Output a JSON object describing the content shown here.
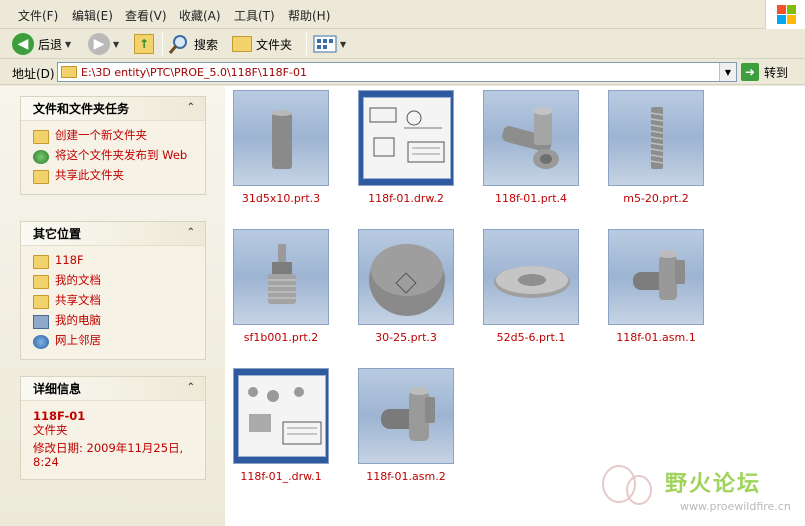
{
  "menu": [
    {
      "label": "文件(F)"
    },
    {
      "label": "编辑(E)"
    },
    {
      "label": "查看(V)"
    },
    {
      "label": "收藏(A)"
    },
    {
      "label": "工具(T)"
    },
    {
      "label": "帮助(H)"
    }
  ],
  "toolbar": {
    "back_label": "后退",
    "search_label": "搜索",
    "folders_label": "文件夹"
  },
  "address": {
    "label": "地址(D)",
    "path": "E:\\3D entity\\PTC\\PROE_5.0\\118F\\118F-01",
    "go_label": "转到"
  },
  "tasks": {
    "title": "文件和文件夹任务",
    "items": [
      {
        "label": "创建一个新文件夹",
        "icon": "new-folder-icon"
      },
      {
        "label": "将这个文件夹发布到 Web",
        "icon": "publish-web-icon"
      },
      {
        "label": "共享此文件夹",
        "icon": "share-folder-icon"
      }
    ]
  },
  "places": {
    "title": "其它位置",
    "items": [
      {
        "label": "118F",
        "icon": "folder-icon"
      },
      {
        "label": "我的文档",
        "icon": "my-documents-icon"
      },
      {
        "label": "共享文档",
        "icon": "shared-documents-icon"
      },
      {
        "label": "我的电脑",
        "icon": "my-computer-icon"
      },
      {
        "label": "网上邻居",
        "icon": "network-icon"
      }
    ]
  },
  "details": {
    "title": "详细信息",
    "name": "118F-01",
    "type": "文件夹",
    "modified": "修改日期: 2009年11月25日, 8:24"
  },
  "files": [
    {
      "name": "31d5x10.prt.3",
      "kind": "part"
    },
    {
      "name": "118f-01.drw.2",
      "kind": "drawing"
    },
    {
      "name": "118f-01.prt.4",
      "kind": "part"
    },
    {
      "name": "m5-20.prt.2",
      "kind": "part"
    },
    {
      "name": "sf1b001.prt.2",
      "kind": "part"
    },
    {
      "name": "30-25.prt.3",
      "kind": "part"
    },
    {
      "name": "52d5-6.prt.1",
      "kind": "part"
    },
    {
      "name": "118f-01.asm.1",
      "kind": "assembly"
    },
    {
      "name": "118f-01_.drw.1",
      "kind": "drawing"
    },
    {
      "name": "118f-01.asm.2",
      "kind": "assembly"
    }
  ],
  "watermark": {
    "text": "野火论坛",
    "url": "www.proewildfire.cn"
  },
  "colors": {
    "link_red": "#c00000",
    "thumb_blue": "#9db4d2",
    "pane_beige": "#ece9d8"
  }
}
